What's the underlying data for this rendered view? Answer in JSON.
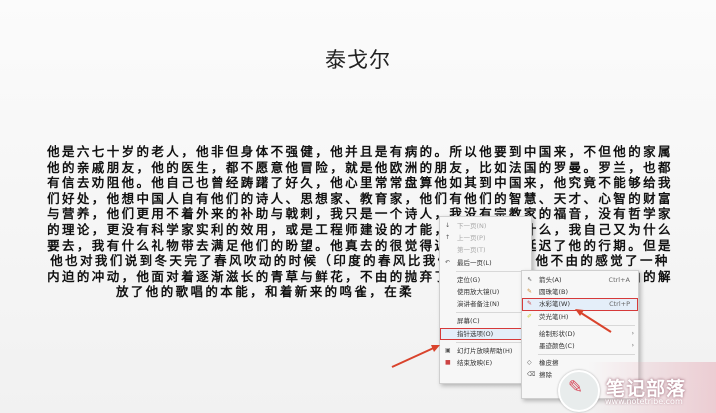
{
  "slide": {
    "title": "泰戈尔",
    "lines": [
      "他是六七十岁的老人，他非但身体不强健，他并且是有病的。所以他要到中国来，不但他的家属",
      "他的亲戚朋友，他的医生，都不愿意他冒险，就是他欧洲的朋友，比如法国的罗曼。罗兰，也都",
      "有信去劝阻他。他自己也曾经踌躇了好久，他心里常常盘算他如其到中国来，他究竟不能够给我",
      "们好处，他想中国人自有他们的诗人、思想家、教育家，他们有他们的智慧、天才、心智的财富",
      "与营养，他们更用不着外来的补助与戟刺，我只是一个诗人，我没有宗教家的福音，没有哲学家",
      "的理论，更没有科学家实利的效用，或是工程师建设的才能，他们要我做什么，我自己又为什么",
      "要去，我有什么礼物带去满足他们的盼望。他真去的很觉得迟疑，所以他延迟了他的行期。但是",
      "他也对我们说到冬天完了春风吹动的时候（印度的春风比我们的吹得早），他不由的感觉了一种",
      "内迫的冲动，他面对着逐渐滋长的青草与鲜花，不由的抛弃了，忘却了他应尽的职务，不由的解",
      "放了他的歌唱的本能，和着新来的鸣雀，在柔"
    ]
  },
  "context_menu": {
    "items": [
      {
        "icon": "arrow-down-icon",
        "label": "下一页(N)",
        "disabled": true
      },
      {
        "icon": "arrow-up-icon",
        "label": "上一页(P)",
        "disabled": true
      },
      {
        "icon": "",
        "label": "第一页(T)",
        "disabled": true
      },
      {
        "icon": "back-icon",
        "label": "最后一页(L)",
        "disabled": false
      },
      {
        "icon": "",
        "label": "定位(G)",
        "disabled": false,
        "submenu": true
      },
      {
        "icon": "",
        "label": "使用放大镜(U)",
        "disabled": false
      },
      {
        "icon": "",
        "label": "演讲者备注(N)",
        "disabled": false
      },
      {
        "icon": "",
        "label": "屏幕(C)",
        "disabled": false,
        "submenu": true
      },
      {
        "icon": "",
        "label": "指针选项(O)",
        "disabled": false,
        "submenu": true,
        "highlighted": true
      },
      {
        "icon": "help-icon",
        "label": "幻灯片放映帮助(H)",
        "disabled": false
      },
      {
        "icon": "end-show-icon",
        "label": "结束放映(E)",
        "disabled": false
      }
    ]
  },
  "pointer_submenu": {
    "items": [
      {
        "icon": "cursor-icon",
        "label": "箭头(A)",
        "shortcut": "Ctrl+A"
      },
      {
        "icon": "ballpoint-pen-icon",
        "label": "圆珠笔(B)",
        "shortcut": ""
      },
      {
        "icon": "watercolor-pen-icon",
        "label": "水彩笔(W)",
        "shortcut": "Ctrl+P",
        "highlighted": true
      },
      {
        "icon": "highlighter-icon",
        "label": "荧光笔(H)",
        "shortcut": ""
      },
      {
        "icon": "",
        "label": "绘制形状(D)",
        "shortcut": "",
        "submenu": true
      },
      {
        "icon": "",
        "label": "墨迹颜色(C)",
        "shortcut": "",
        "submenu": true
      },
      {
        "icon": "eraser-icon",
        "label": "橡皮擦",
        "shortcut": ""
      },
      {
        "icon": "erase-all-icon",
        "label": "擦除",
        "shortcut": ""
      }
    ]
  },
  "watermark": {
    "name": "笔记部落",
    "url": "www.notetribe.com"
  },
  "colors": {
    "highlight_outline": "#d63a3a",
    "annotation_arrow": "#d9432c",
    "watermark_pink": "#d94a5c"
  }
}
